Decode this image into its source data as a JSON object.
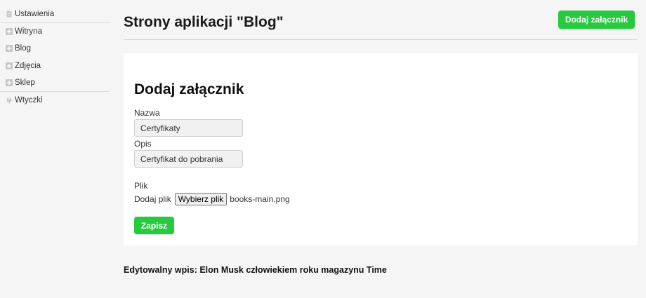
{
  "sidebar": {
    "items": [
      {
        "label": "Ustawienia",
        "icon": "document-icon"
      },
      {
        "label": "Witryna",
        "icon": "plus-box-icon"
      },
      {
        "label": "Blog",
        "icon": "plus-box-icon"
      },
      {
        "label": "Zdjęcia",
        "icon": "plus-box-icon"
      },
      {
        "label": "Sklep",
        "icon": "plus-box-icon"
      },
      {
        "label": "Wtyczki",
        "icon": "plug-icon"
      }
    ]
  },
  "header": {
    "title": "Strony aplikacji \"Blog\"",
    "add_button": "Dodaj załącznik"
  },
  "form": {
    "title": "Dodaj załącznik",
    "name_label": "Nazwa",
    "name_value": "Certyfikaty",
    "desc_label": "Opis",
    "desc_value": "Certyfikat do pobrania",
    "file_label": "Plik",
    "file_prefix": "Dodaj plik",
    "file_button": "Wybierz plik",
    "file_name": "books-main.png",
    "submit": "Zapisz"
  },
  "entry": {
    "text": "Edytowalny wpis: Elon Musk człowiekiem roku magazynu Time"
  },
  "colors": {
    "accent_green": "#27c93f",
    "icon_gray": "#c8c8c8"
  }
}
